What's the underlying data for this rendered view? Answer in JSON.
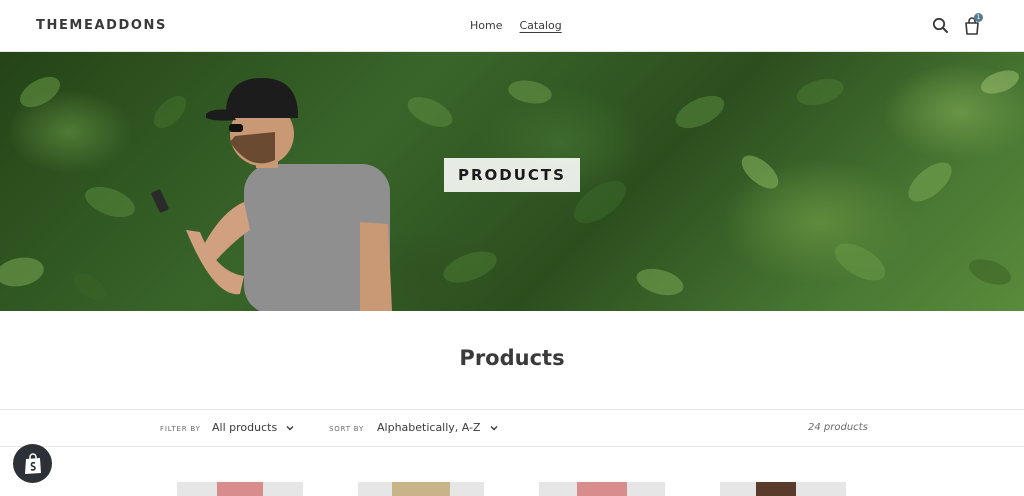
{
  "header": {
    "logo": "THEMEADDONS",
    "nav": [
      {
        "label": "Home",
        "active": false
      },
      {
        "label": "Catalog",
        "active": true
      }
    ],
    "search_icon": "search-icon",
    "cart_icon": "shopping-bag-icon",
    "cart_count": "1",
    "accent_color": "#557b97"
  },
  "hero": {
    "title": "PRODUCTS"
  },
  "page": {
    "title": "Products"
  },
  "filter_bar": {
    "filter_label": "FILTER BY",
    "filter_value": "All products",
    "sort_label": "SORT BY",
    "sort_value": "Alphabetically, A-Z",
    "product_count": "24 products"
  },
  "shopify_badge": {
    "icon": "shopify-bag-icon"
  },
  "products": [
    {
      "icon": "product-thumbnail",
      "accent": "#d98c8c"
    },
    {
      "icon": "product-thumbnail",
      "accent": "#c9b48a"
    },
    {
      "icon": "product-thumbnail",
      "accent": "#d98c8c"
    },
    {
      "icon": "product-thumbnail",
      "accent": "#5a3a2a"
    }
  ]
}
